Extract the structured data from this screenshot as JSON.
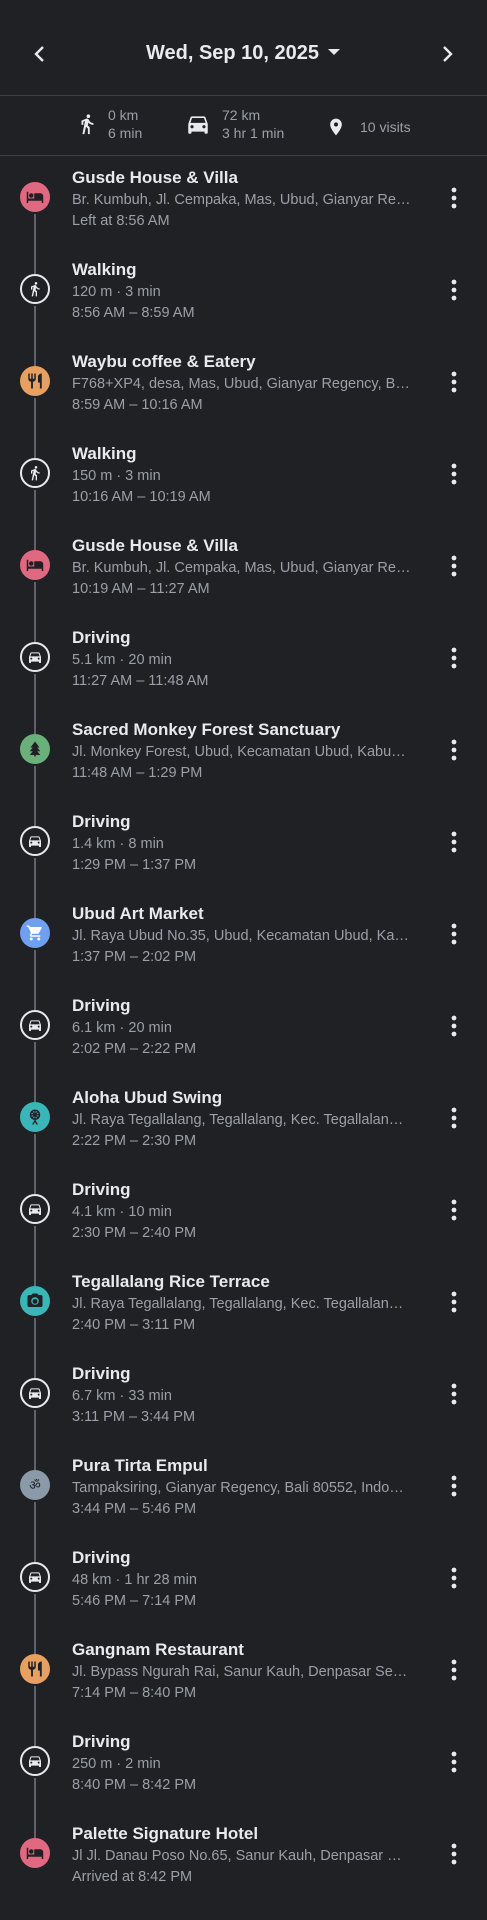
{
  "header": {
    "date": "Wed, Sep 10, 2025"
  },
  "summary": {
    "walk_distance": "0 km",
    "walk_duration": "6 min",
    "drive_distance": "72 km",
    "drive_duration": "3 hr 1 min",
    "visits": "10 visits"
  },
  "timeline": [
    {
      "kind": "place",
      "icon": "bed-icon",
      "color": "#e06880",
      "title": "Gusde House & Villa",
      "sub": "Br. Kumbuh, Jl. Cempaka, Mas, Ubud, Gianyar Re…",
      "time": "Left at 8:56 AM"
    },
    {
      "kind": "walk",
      "icon": "walking-icon",
      "title": "Walking",
      "sub": "120 m · 3 min",
      "time": "8:56 AM – 8:59 AM"
    },
    {
      "kind": "place",
      "icon": "restaurant-icon",
      "color": "#e8a060",
      "title": "Waybu coffee & Eatery",
      "sub": "F768+XP4, desa, Mas, Ubud, Gianyar Regency, B…",
      "time": "8:59 AM – 10:16 AM"
    },
    {
      "kind": "walk",
      "icon": "walking-icon",
      "title": "Walking",
      "sub": "150 m · 3 min",
      "time": "10:16 AM – 10:19 AM"
    },
    {
      "kind": "place",
      "icon": "bed-icon",
      "color": "#e06880",
      "title": "Gusde House & Villa",
      "sub": "Br. Kumbuh, Jl. Cempaka, Mas, Ubud, Gianyar Re…",
      "time": "10:19 AM – 11:27 AM"
    },
    {
      "kind": "drive",
      "icon": "car-icon",
      "title": "Driving",
      "sub": "5.1 km · 20 min",
      "time": "11:27 AM – 11:48 AM"
    },
    {
      "kind": "place",
      "icon": "tree-icon",
      "color": "#69b07a",
      "title": "Sacred Monkey Forest Sanctuary",
      "sub": "Jl. Monkey Forest, Ubud, Kecamatan Ubud, Kabu…",
      "time": "11:48 AM – 1:29 PM"
    },
    {
      "kind": "drive",
      "icon": "car-icon",
      "title": "Driving",
      "sub": "1.4 km · 8 min",
      "time": "1:29 PM – 1:37 PM"
    },
    {
      "kind": "place",
      "icon": "shopping-cart-icon",
      "color": "#6fa0f0",
      "title": "Ubud Art Market",
      "sub": "Jl. Raya Ubud No.35, Ubud, Kecamatan Ubud, Ka…",
      "time": "1:37 PM – 2:02 PM"
    },
    {
      "kind": "drive",
      "icon": "car-icon",
      "title": "Driving",
      "sub": "6.1 km · 20 min",
      "time": "2:02 PM – 2:22 PM"
    },
    {
      "kind": "place",
      "icon": "amusement-park-icon",
      "color": "#3ab5b8",
      "title": "Aloha Ubud Swing",
      "sub": "Jl. Raya Tegallalang, Tegallalang, Kec. Tegallalan…",
      "time": "2:22 PM – 2:30 PM"
    },
    {
      "kind": "drive",
      "icon": "car-icon",
      "title": "Driving",
      "sub": "4.1 km · 10 min",
      "time": "2:30 PM – 2:40 PM"
    },
    {
      "kind": "place",
      "icon": "camera-icon",
      "color": "#3ab5b8",
      "title": "Tegallalang Rice Terrace",
      "sub": "Jl. Raya Tegallalang, Tegallalang, Kec. Tegallalan…",
      "time": "2:40 PM – 3:11 PM"
    },
    {
      "kind": "drive",
      "icon": "car-icon",
      "title": "Driving",
      "sub": "6.7 km · 33 min",
      "time": "3:11 PM – 3:44 PM"
    },
    {
      "kind": "place",
      "icon": "om-icon",
      "color": "#8a9aa8",
      "title": "Pura Tirta Empul",
      "sub": "Tampaksiring, Gianyar Regency, Bali 80552, Indo…",
      "time": "3:44 PM – 5:46 PM"
    },
    {
      "kind": "drive",
      "icon": "car-icon",
      "title": "Driving",
      "sub": "48 km · 1 hr 28 min",
      "time": "5:46 PM – 7:14 PM"
    },
    {
      "kind": "place",
      "icon": "restaurant-icon",
      "color": "#e8a060",
      "title": "Gangnam Restaurant",
      "sub": "Jl. Bypass Ngurah Rai, Sanur Kauh, Denpasar Se…",
      "time": "7:14 PM – 8:40 PM"
    },
    {
      "kind": "drive",
      "icon": "car-icon",
      "title": "Driving",
      "sub": "250 m · 2 min",
      "time": "8:40 PM – 8:42 PM"
    },
    {
      "kind": "place",
      "icon": "bed-icon",
      "color": "#e06880",
      "title": "Palette Signature Hotel",
      "sub": "Jl Jl. Danau Poso No.65, Sanur Kauh, Denpasar …",
      "time": "Arrived at 8:42 PM"
    }
  ]
}
